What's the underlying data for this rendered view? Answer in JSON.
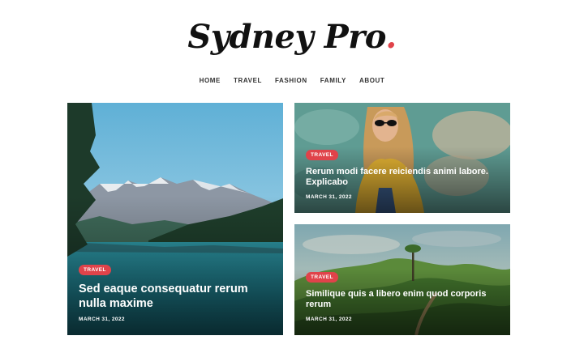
{
  "site": {
    "logo_text": "Sydney Pro",
    "logo_dot": ".",
    "accent_color": "#e0434a"
  },
  "nav": {
    "items": [
      {
        "label": "HOME"
      },
      {
        "label": "TRAVEL"
      },
      {
        "label": "FASHION"
      },
      {
        "label": "FAMILY"
      },
      {
        "label": "ABOUT"
      }
    ]
  },
  "posts": [
    {
      "category": "TRAVEL",
      "title": "Sed eaque consequatur rerum nulla maxime",
      "date": "MARCH 31, 2022",
      "image": "mountain-lake-photo"
    },
    {
      "category": "TRAVEL",
      "title": "Rerum modi facere reiciendis animi labore. Explicabo",
      "date": "MARCH 31, 2022",
      "image": "woman-sunglasses-photo"
    },
    {
      "category": "TRAVEL",
      "title": "Similique quis a libero enim quod corporis rerum",
      "date": "MARCH 31, 2022",
      "image": "green-hills-photo"
    }
  ]
}
